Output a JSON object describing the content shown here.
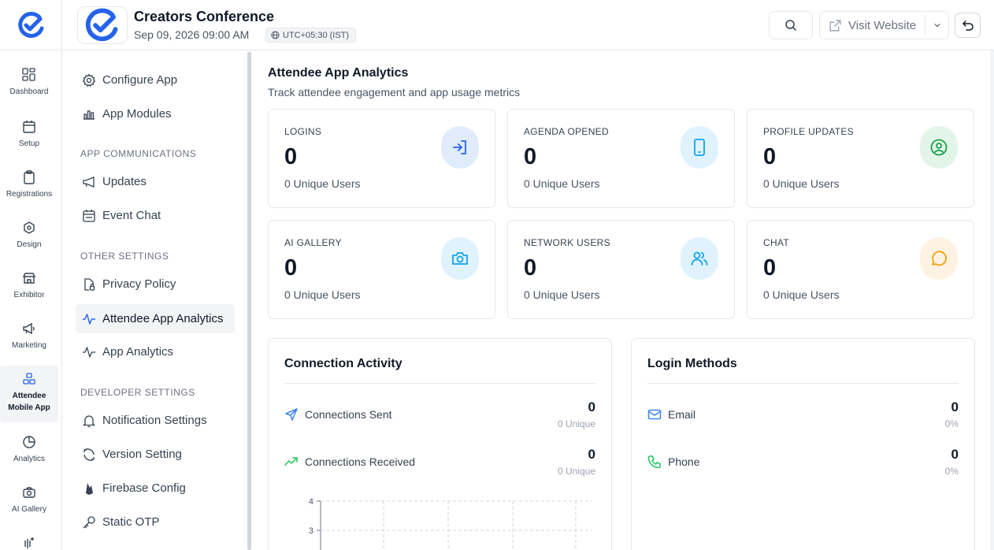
{
  "rail": {
    "items": [
      {
        "label": "Dashboard",
        "icon": "dashboard-icon"
      },
      {
        "label": "Setup",
        "icon": "calendar-icon"
      },
      {
        "label": "Registrations",
        "icon": "clipboard-icon"
      },
      {
        "label": "Design",
        "icon": "hexagon-icon"
      },
      {
        "label": "Exhibitor",
        "icon": "store-icon"
      },
      {
        "label": "Marketing",
        "icon": "megaphone-icon"
      },
      {
        "label": "Attendee\nMobile App",
        "icon": "boxes-icon"
      },
      {
        "label": "Analytics",
        "icon": "pie-chart-icon"
      },
      {
        "label": "AI Gallery",
        "icon": "camera-sparkle-icon"
      }
    ]
  },
  "header": {
    "event_title": "Creators Conference",
    "event_date": "Sep 09, 2026 09:00 AM",
    "timezone": "UTC+05:30 (IST)",
    "visit_label": "Visit Website"
  },
  "sidebar": {
    "items": [
      {
        "label": "Configure App",
        "icon": "gear-icon"
      },
      {
        "label": "App Modules",
        "icon": "bar-chart-icon"
      },
      {
        "section": "APP COMMUNICATIONS"
      },
      {
        "label": "Updates",
        "icon": "megaphone-icon"
      },
      {
        "label": "Event Chat",
        "icon": "calendar-chat-icon"
      },
      {
        "section": "OTHER SETTINGS"
      },
      {
        "label": "Privacy Policy",
        "icon": "document-lock-icon"
      },
      {
        "label": "Attendee App Analytics",
        "icon": "activity-icon",
        "active": true
      },
      {
        "label": "App Analytics",
        "icon": "activity-icon"
      },
      {
        "section": "DEVELOPER SETTINGS"
      },
      {
        "label": "Notification Settings",
        "icon": "bell-icon"
      },
      {
        "label": "Version Setting",
        "icon": "version-icon"
      },
      {
        "label": "Firebase Config",
        "icon": "flame-icon"
      },
      {
        "label": "Static OTP",
        "icon": "key-icon"
      }
    ]
  },
  "main": {
    "title": "Attendee App Analytics",
    "subtitle": "Track attendee engagement and app usage metrics",
    "stats": [
      {
        "label": "LOGINS",
        "value": "0",
        "unique": "0 Unique Users",
        "icon": "login-icon",
        "color": "#2563eb",
        "bg": "#e0ecfb"
      },
      {
        "label": "AGENDA OPENED",
        "value": "0",
        "unique": "0 Unique Users",
        "icon": "tablet-icon",
        "color": "#0ea5e9",
        "bg": "#e0f2fe"
      },
      {
        "label": "PROFILE UPDATES",
        "value": "0",
        "unique": "0 Unique Users",
        "icon": "user-circle-icon",
        "color": "#16a34a",
        "bg": "#e3f5e8"
      },
      {
        "label": "AI GALLERY",
        "value": "0",
        "unique": "0 Unique Users",
        "icon": "camera-icon",
        "color": "#0ea5e9",
        "bg": "#e0f2fe"
      },
      {
        "label": "NETWORK USERS",
        "value": "0",
        "unique": "0 Unique Users",
        "icon": "users-icon",
        "color": "#0ea5e9",
        "bg": "#e0f2fe"
      },
      {
        "label": "CHAT",
        "value": "0",
        "unique": "0 Unique Users",
        "icon": "chat-bubble-icon",
        "color": "#f59e0b",
        "bg": "#fef3e2"
      }
    ],
    "connection": {
      "title": "Connection Activity",
      "rows": [
        {
          "label": "Connections Sent",
          "value": "0",
          "sub": "0 Unique",
          "icon": "send-icon",
          "color": "#3b82f6"
        },
        {
          "label": "Connections Received",
          "value": "0",
          "sub": "0 Unique",
          "icon": "trend-up-icon",
          "color": "#22c55e"
        }
      ],
      "chart_ticks": [
        "4",
        "3"
      ]
    },
    "login_methods": {
      "title": "Login Methods",
      "rows": [
        {
          "label": "Email",
          "value": "0",
          "sub": "0%",
          "icon": "mail-icon",
          "color": "#3b82f6"
        },
        {
          "label": "Phone",
          "value": "0",
          "sub": "0%",
          "icon": "phone-icon",
          "color": "#22c55e"
        }
      ]
    }
  }
}
